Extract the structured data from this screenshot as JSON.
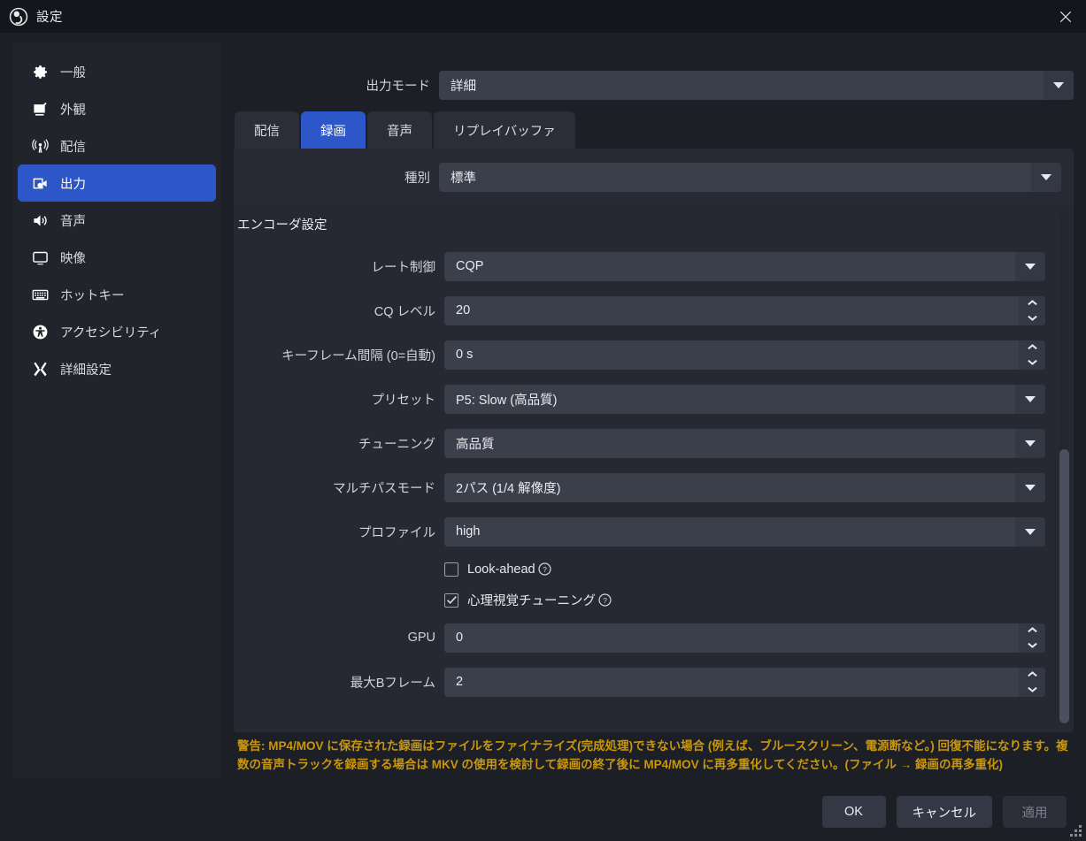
{
  "window": {
    "title": "設定",
    "logo_icon": "obs-logo-icon",
    "close_icon": "close-icon"
  },
  "sidebar": {
    "items": [
      {
        "label": "一般",
        "icon": "gear-icon",
        "active": false
      },
      {
        "label": "外観",
        "icon": "appearance-icon",
        "active": false
      },
      {
        "label": "配信",
        "icon": "broadcast-icon",
        "active": false
      },
      {
        "label": "出力",
        "icon": "output-icon",
        "active": true
      },
      {
        "label": "音声",
        "icon": "speaker-icon",
        "active": false
      },
      {
        "label": "映像",
        "icon": "monitor-icon",
        "active": false
      },
      {
        "label": "ホットキー",
        "icon": "keyboard-icon",
        "active": false
      },
      {
        "label": "アクセシビリティ",
        "icon": "accessibility-icon",
        "active": false
      },
      {
        "label": "詳細設定",
        "icon": "tools-icon",
        "active": false
      }
    ]
  },
  "main": {
    "output_mode": {
      "label": "出力モード",
      "value": "詳細"
    },
    "tabs": [
      {
        "label": "配信",
        "active": false
      },
      {
        "label": "録画",
        "active": true
      },
      {
        "label": "音声",
        "active": false
      },
      {
        "label": "リプレイバッファ",
        "active": false
      }
    ],
    "kind": {
      "label": "種別",
      "value": "標準"
    },
    "group_title": "エンコーダ設定",
    "fields": [
      {
        "label": "レート制御",
        "value": "CQP",
        "type": "combo"
      },
      {
        "label": "CQ レベル",
        "value": "20",
        "type": "spin"
      },
      {
        "label": "キーフレーム間隔 (0=自動)",
        "value": "0 s",
        "type": "spin"
      },
      {
        "label": "プリセット",
        "value": "P5: Slow (高品質)",
        "type": "combo"
      },
      {
        "label": "チューニング",
        "value": "高品質",
        "type": "combo"
      },
      {
        "label": "マルチパスモード",
        "value": "2パス (1/4 解像度)",
        "type": "combo"
      },
      {
        "label": "プロファイル",
        "value": "high",
        "type": "combo"
      }
    ],
    "checkboxes": [
      {
        "label": "Look-ahead",
        "checked": false,
        "help_icon": "help-icon"
      },
      {
        "label": "心理視覚チューニング",
        "checked": true,
        "help_icon": "help-icon"
      }
    ],
    "fields_after": [
      {
        "label": "GPU",
        "value": "0",
        "type": "spin"
      },
      {
        "label": "最大Bフレーム",
        "value": "2",
        "type": "spin"
      }
    ],
    "warning": "警告: MP4/MOV に保存された録画はファイルをファイナライズ(完成処理)できない場合 (例えば、ブルースクリーン、電源断など。) 回復不能になります。複数の音声トラックを録画する場合は MKV の使用を検討して録画の終了後に MP4/MOV に再多重化してください。(ファイル → 録画の再多重化)"
  },
  "footer": {
    "ok": "OK",
    "cancel": "キャンセル",
    "apply": "適用"
  },
  "colors": {
    "accent": "#2d56c8",
    "warning": "#c9960c",
    "window_bg": "#1d1f26",
    "panel_bg": "#272a33",
    "input_bg": "#3b3f4c"
  }
}
